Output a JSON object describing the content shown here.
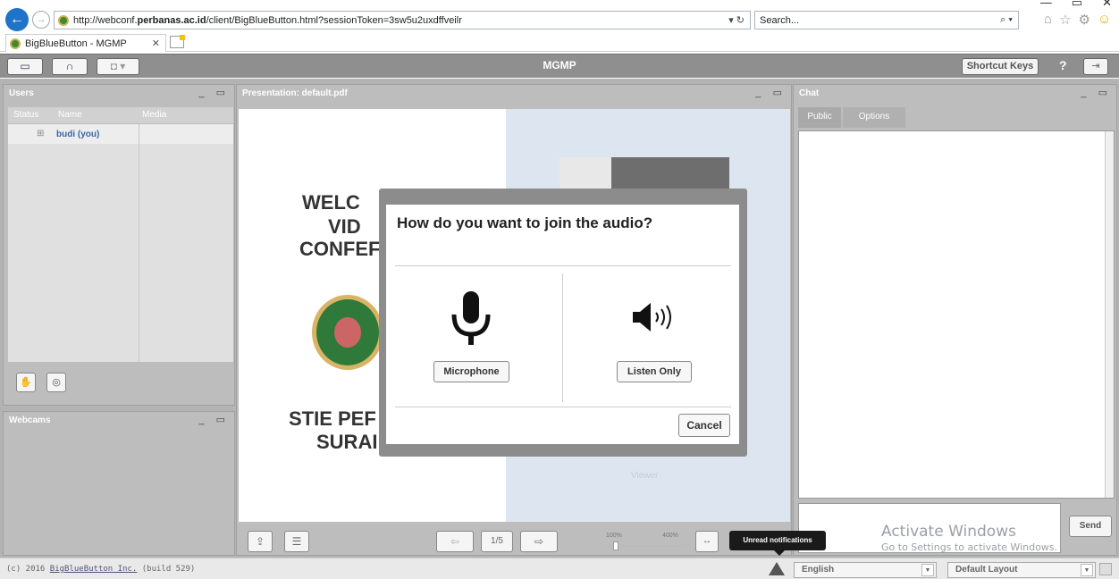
{
  "browser": {
    "url_prefix": "http://webconf.",
    "url_domain": "perbanas.ac.id",
    "url_path": "/client/BigBlueButton.html?sessionToken=3sw5u2uxdffveilr",
    "url_controls": "▾ ↻",
    "search_placeholder": "Search...",
    "tab_title": "BigBlueButton - MGMP"
  },
  "app": {
    "title": "MGMP",
    "shortcut_keys": "Shortcut Keys",
    "help": "?"
  },
  "users_panel": {
    "title": "Users",
    "columns": [
      "Status",
      "Name",
      "Media"
    ],
    "users": [
      {
        "name": "budi (you)"
      }
    ]
  },
  "webcams_panel": {
    "title": "Webcams"
  },
  "presentation": {
    "title": "Presentation: default.pdf",
    "slide_lines": [
      "WELC",
      "VID",
      "CONFEF",
      "STIE PEF",
      "SURAI"
    ],
    "viewer_label": "Viewer",
    "page": "1/5",
    "zoom_min": "100%",
    "zoom_max": "400%"
  },
  "chat_panel": {
    "title": "Chat",
    "tabs": [
      "Public",
      "Options"
    ],
    "send": "Send"
  },
  "watermark": {
    "line1": "Activate Windows",
    "line2": "Go to Settings to activate Windows."
  },
  "footer": {
    "copyright_prefix": "(c) 2016 ",
    "copyright_link": "BigBlueButton Inc.",
    "copyright_suffix": " (build 529)",
    "language": "English",
    "layout": "Default Layout",
    "tooltip": "Unread notifications"
  },
  "audio_dialog": {
    "question": "How do you want to join the audio?",
    "microphone": "Microphone",
    "listen_only": "Listen Only",
    "cancel": "Cancel"
  }
}
